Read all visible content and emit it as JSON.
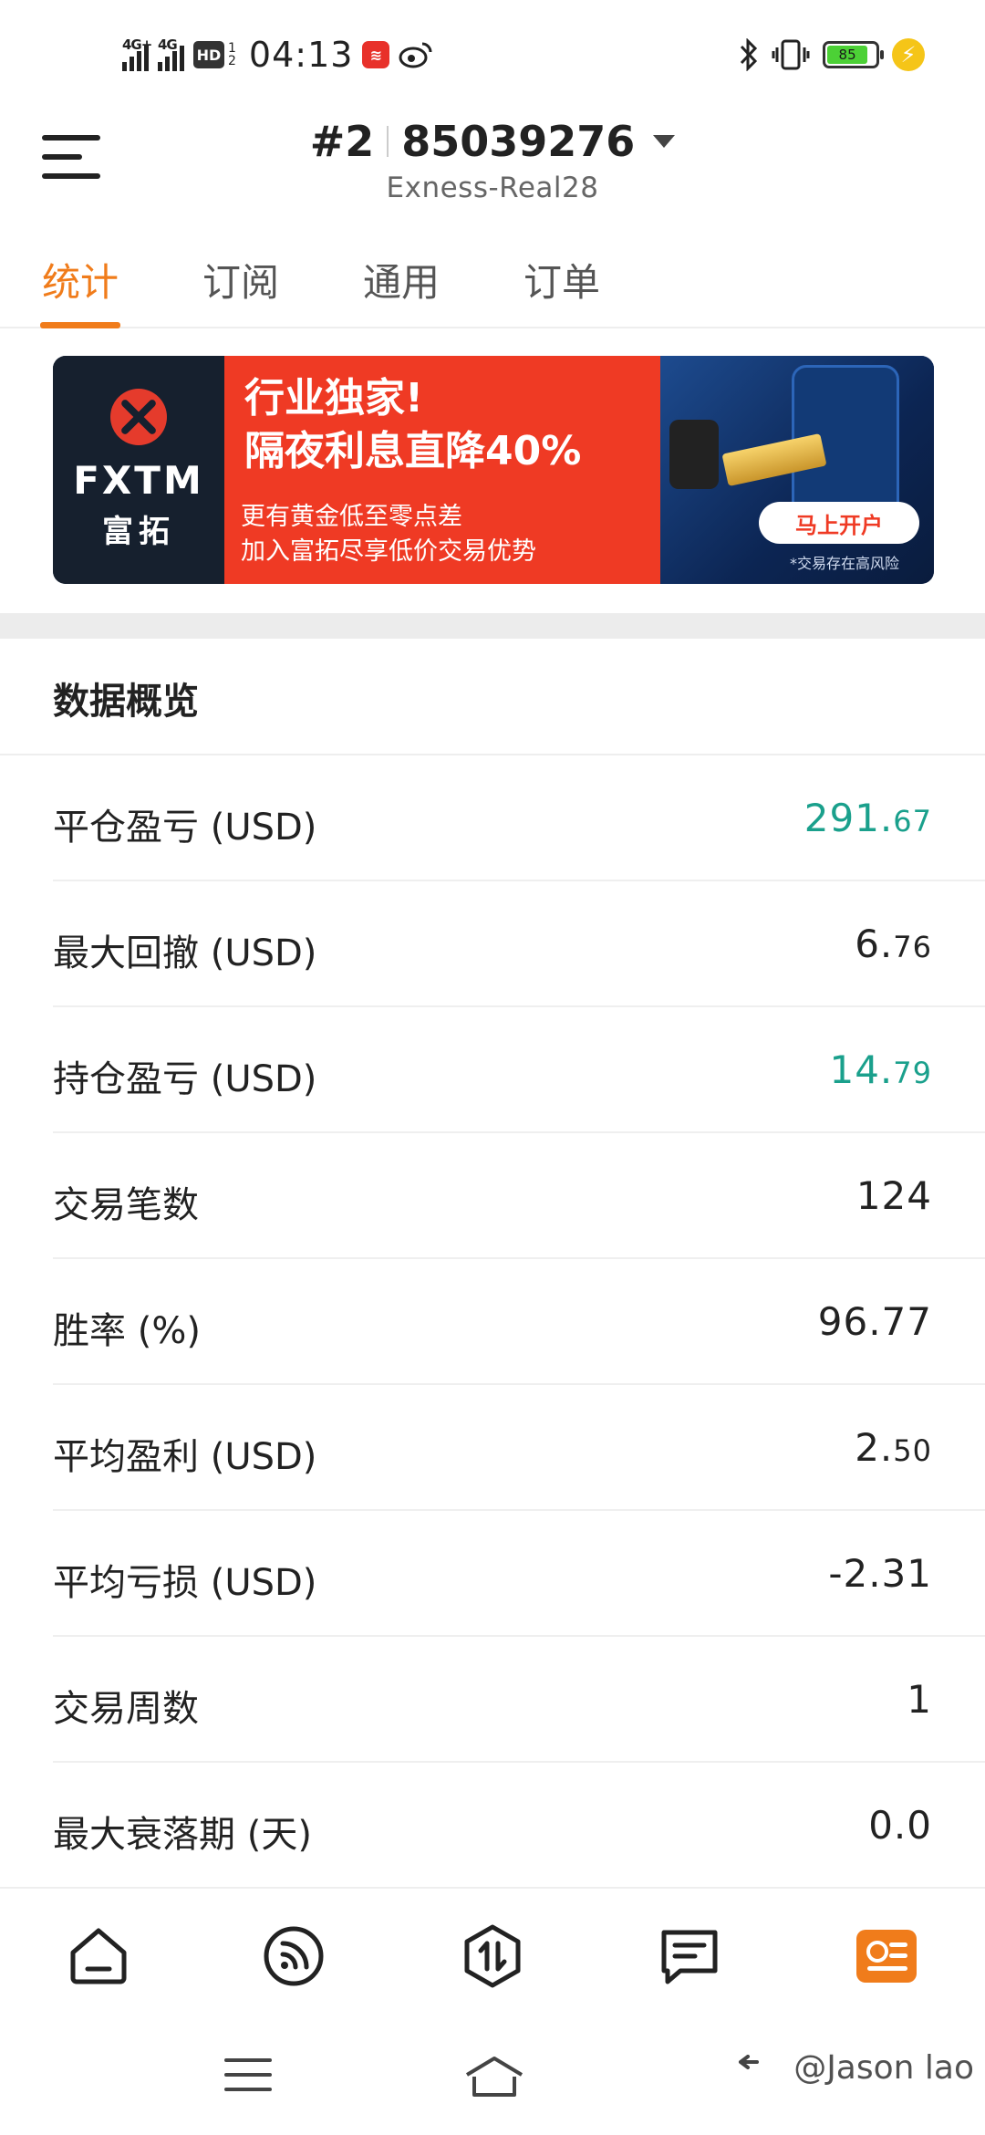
{
  "status_bar": {
    "net1": "4G+",
    "net2": "4G",
    "hd": "HD",
    "hd_sub1": "1",
    "hd_sub2": "2",
    "time": "04:13",
    "battery": "85"
  },
  "header": {
    "account_prefix": "#2",
    "account_number": "85039276",
    "server": "Exness-Real28"
  },
  "tabs": [
    {
      "label": "统计",
      "active": true
    },
    {
      "label": "订阅",
      "active": false
    },
    {
      "label": "通用",
      "active": false
    },
    {
      "label": "订单",
      "active": false
    }
  ],
  "banner": {
    "brand": "FXTM",
    "brand_cn": "富拓",
    "headline1": "行业独家!",
    "headline2": "隔夜利息直降40%",
    "sub1": "更有黄金低至零点差",
    "sub2": "加入富拓尽享低价交易优势",
    "cta": "马上开户",
    "risk": "*交易存在高风险"
  },
  "overview": {
    "title": "数据概览",
    "rows": [
      {
        "label": "平仓盈亏 (USD)",
        "int": "291.",
        "dec": "67",
        "color": "#1aa08c"
      },
      {
        "label": "最大回撤 (USD)",
        "int": "6.",
        "dec": "76",
        "color": "#222222"
      },
      {
        "label": "持仓盈亏 (USD)",
        "int": "14.",
        "dec": "79",
        "color": "#1aa08c"
      },
      {
        "label": "交易笔数",
        "int": "124",
        "dec": "",
        "color": "#222222"
      },
      {
        "label": "胜率 (%)",
        "int": "96.77",
        "dec": "",
        "color": "#222222"
      },
      {
        "label": "平均盈利 (USD)",
        "int": "2.",
        "dec": "50",
        "color": "#222222"
      },
      {
        "label": "平均亏损 (USD)",
        "int": "-2.31",
        "dec": "",
        "color": "#222222"
      },
      {
        "label": "交易周数",
        "int": "1",
        "dec": "",
        "color": "#222222"
      },
      {
        "label": "最大衰落期 (天)",
        "int": "0.0",
        "dec": "",
        "color": "#222222"
      }
    ]
  },
  "bottom_nav": {
    "items": [
      "home-icon",
      "signal-feed-icon",
      "trade-icon",
      "news-icon",
      "profile-card-icon"
    ],
    "active_color": "#f07c1b"
  },
  "watermark": "@Jason lao"
}
